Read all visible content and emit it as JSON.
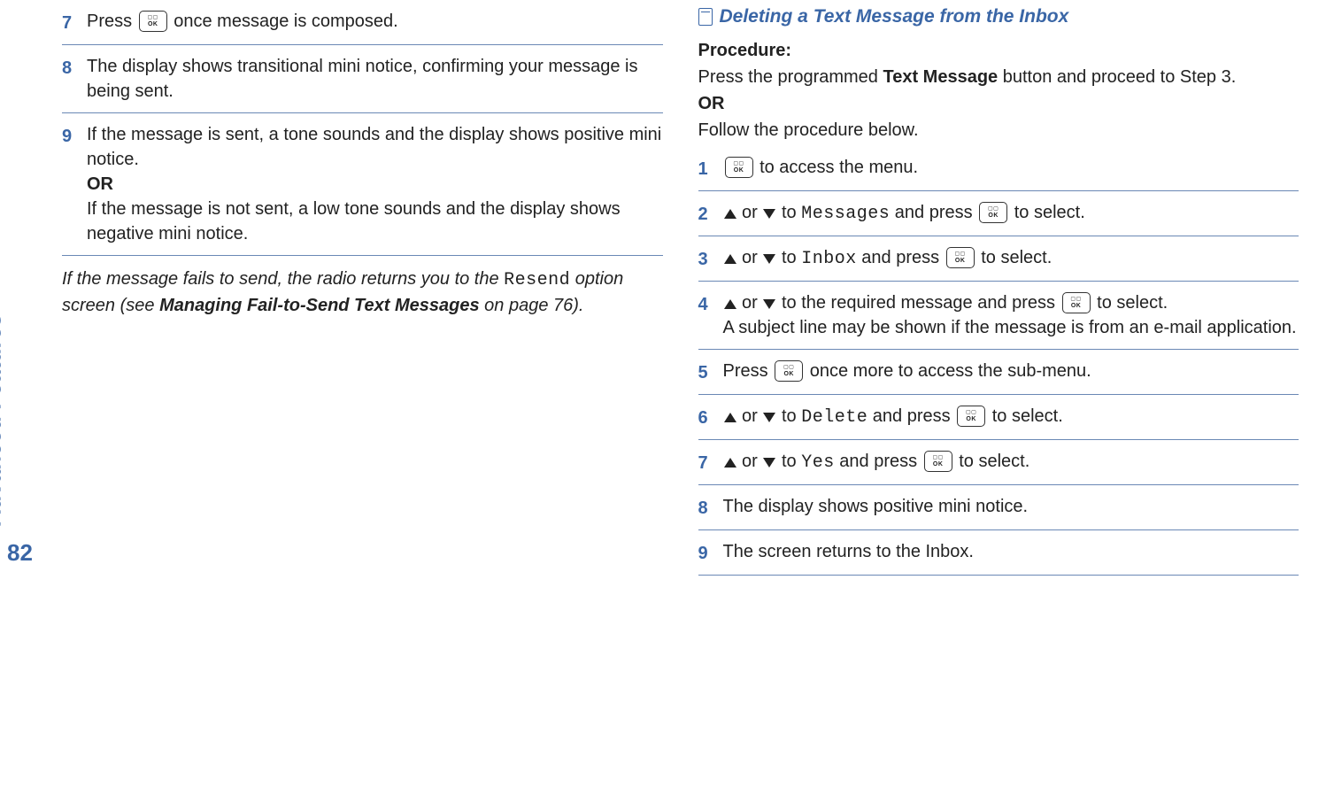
{
  "margin": {
    "vertical_label": "Advanced Features",
    "page_number": "82"
  },
  "icons": {
    "ok_top": "▢▢",
    "ok_bottom": "OK"
  },
  "left": {
    "step7": {
      "num": "7",
      "t1": "Press ",
      "t2": " once message is composed."
    },
    "step8": {
      "num": "8",
      "text": "The display shows transitional mini notice, confirming your message is being sent."
    },
    "step9": {
      "num": "9",
      "t1": "If the message is sent, a tone sounds and the display shows positive mini notice.",
      "or": "OR",
      "t2": "If the message is not sent, a low tone sounds and the display shows negative mini notice."
    },
    "note": {
      "p1a": "If the message fails to send, the radio returns you to the ",
      "resend": "Resend",
      "p1b": " option screen (see ",
      "bold": "Managing Fail-to-Send Text Messages",
      "p1c": " on page 76)."
    }
  },
  "right": {
    "heading": "Deleting a Text Message from the Inbox",
    "intro": {
      "proc": "Procedure:",
      "l1a": "Press the programmed ",
      "l1b": "Text Message",
      "l1c": " button and proceed to Step 3.",
      "or": "OR",
      "l2": "Follow the procedure below."
    },
    "s1": {
      "num": "1",
      "t": " to access the menu."
    },
    "s2": {
      "num": "2",
      "or": " or ",
      "to": " to ",
      "msg": "Messages",
      "and": " and press ",
      "sel": " to select."
    },
    "s3": {
      "num": "3",
      "or": " or ",
      "to": " to ",
      "inbox": "Inbox",
      "and": " and press ",
      "sel": " to select."
    },
    "s4": {
      "num": "4",
      "or": " or ",
      "to": " to the required message and press ",
      "sel": " to select.",
      "sub": "A subject line may be shown if the message is from an e-mail application."
    },
    "s5": {
      "num": "5",
      "t1": "Press ",
      "t2": " once more to access the sub-menu."
    },
    "s6": {
      "num": "6",
      "or": " or ",
      "to": " to ",
      "del": "Delete",
      "and": " and press ",
      "sel": " to select."
    },
    "s7": {
      "num": "7",
      "or": " or ",
      "to": " to ",
      "yes": "Yes",
      "and": " and press ",
      "sel": " to select."
    },
    "s8": {
      "num": "8",
      "t": "The display shows positive mini notice."
    },
    "s9": {
      "num": "9",
      "t": "The screen returns to the Inbox."
    }
  }
}
